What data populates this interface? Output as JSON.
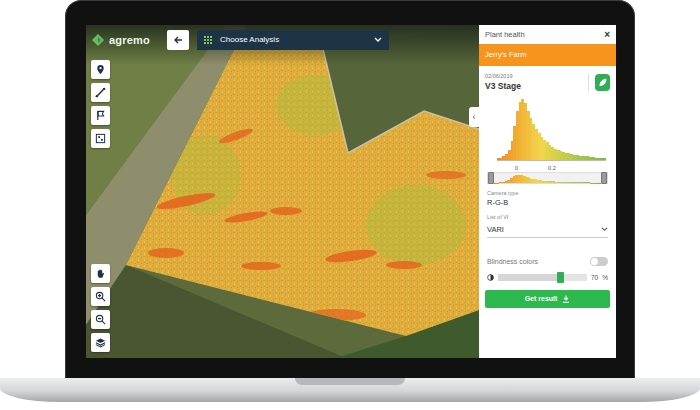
{
  "logo": {
    "text": "agremo"
  },
  "top_bar": {
    "analysis_label": "Choose Analysis"
  },
  "map": {
    "collapse_toggle": "‹"
  },
  "panel": {
    "title": "Plant health",
    "close": "×",
    "farm": "Jerry's Farm",
    "date": "02/06/2019",
    "stage": "V3 Stage",
    "histogram": {
      "values": [
        2,
        3,
        5,
        9,
        16,
        30,
        55,
        80,
        95,
        100,
        92,
        80,
        68,
        58,
        50,
        43,
        37,
        32,
        28,
        24,
        21,
        18,
        16,
        14,
        12,
        11,
        10,
        9,
        8,
        7,
        6,
        6,
        5,
        5,
        4,
        4,
        3,
        3,
        2,
        2
      ]
    },
    "range": {
      "ticks": [
        "0",
        "0.2"
      ],
      "low_level": 0,
      "high_level": 1
    },
    "camera": {
      "label": "Camera type",
      "value": "R-G-B"
    },
    "vi": {
      "label": "List of VI",
      "value": "VARI"
    },
    "blindness": {
      "label": "Blindness colors",
      "on": false
    },
    "opacity": {
      "level": 0.7,
      "reading": "70",
      "unit": "%"
    },
    "button": {
      "label": "Get result"
    }
  }
}
